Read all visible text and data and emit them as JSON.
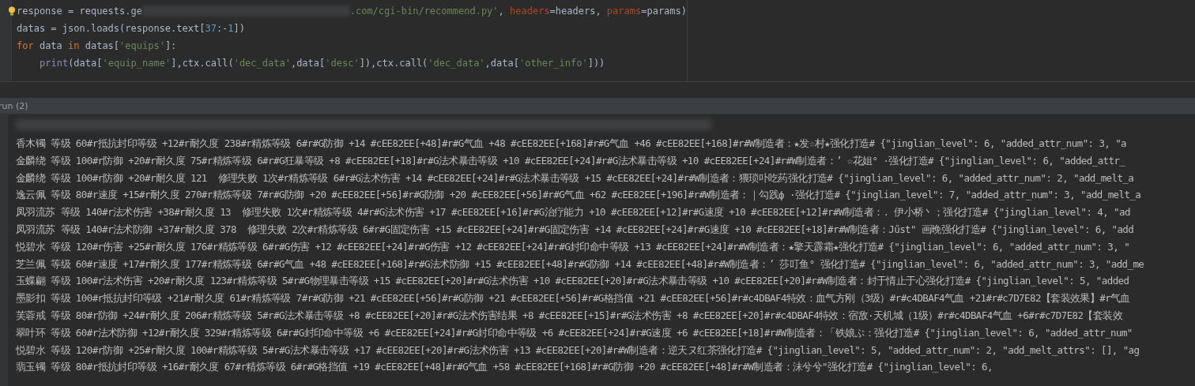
{
  "editor": {
    "lines": [
      {
        "tokens": [
          {
            "kind": "plain",
            "text": "response = requests.ge"
          },
          {
            "kind": "redacted"
          },
          {
            "kind": "string",
            "text": ".com/cgi-bin/recommend.py'"
          },
          {
            "kind": "plain",
            "text": ", "
          },
          {
            "kind": "param",
            "text": "headers"
          },
          {
            "kind": "plain",
            "text": "=headers, "
          },
          {
            "kind": "param",
            "text": "params"
          },
          {
            "kind": "plain",
            "text": "=params)"
          }
        ]
      },
      {
        "tokens": [
          {
            "kind": "plain",
            "text": "datas = json.loads(response.text["
          },
          {
            "kind": "number",
            "text": "37"
          },
          {
            "kind": "plain",
            "text": ":-"
          },
          {
            "kind": "number",
            "text": "1"
          },
          {
            "kind": "plain",
            "text": "])"
          }
        ]
      },
      {
        "tokens": [
          {
            "kind": "keyword",
            "text": "for"
          },
          {
            "kind": "plain",
            "text": " data "
          },
          {
            "kind": "keyword",
            "text": "in"
          },
          {
            "kind": "plain",
            "text": " datas["
          },
          {
            "kind": "string",
            "text": "'equips'"
          },
          {
            "kind": "plain",
            "text": "]:"
          }
        ]
      },
      {
        "indented": true,
        "tokens": [
          {
            "kind": "builtin",
            "text": "print"
          },
          {
            "kind": "plain",
            "text": "(data["
          },
          {
            "kind": "string",
            "text": "'equip_name'"
          },
          {
            "kind": "plain",
            "text": "],ctx.call("
          },
          {
            "kind": "string",
            "text": "'dec_data'"
          },
          {
            "kind": "plain",
            "text": ",data["
          },
          {
            "kind": "string",
            "text": "'desc'"
          },
          {
            "kind": "plain",
            "text": "]),ctx.call("
          },
          {
            "kind": "string",
            "text": "'dec_data'"
          },
          {
            "kind": "plain",
            "text": ",data["
          },
          {
            "kind": "string",
            "text": "'other_info'"
          },
          {
            "kind": "plain",
            "text": "]))"
          }
        ]
      }
    ]
  },
  "run_tab": {
    "label": "run (2)"
  },
  "console": {
    "lines": [
      "香木镯 等级 60#r抵抗封印等级 +12#r耐久度 238#r精炼等级 6#r#G防御 +14 #cEE82EE[+48]#r#G气血 +48 #cEE82EE[+168]#r#G气血 +46 #cEE82EE[+168]#r#W制造者：★发☆村★强化打造# {\"jinglian_level\": 6, \"added_attr_num\": 3, \"a",
      "金麟绕 等级 100#r防御 +20#r耐久度 75#r精炼等级 6#r#G狂暴等级 +8 #cEE82EE[+18]#r#G法术暴击等级 +10 #cEE82EE[+24]#r#G法术暴击等级 +10 #cEE82EE[+24]#r#W制造者：’ ☆花姐° ·强化打造# {\"jinglian_level\": 6, \"added_attr_",
      "金麟绕 等级 100#r防御 +20#r耐久度 121  修理失败 1次#r精炼等级 6#r#G法术伤害 +14 #cEE82EE[+24]#r#G法术暴击等级 +15 #cEE82EE[+24]#r#W制造者：猥琐卟吃药强化打造# {\"jinglian_level\": 6, \"added_attr_num\": 2, \"add_melt_a",
      "逸云佩 等级 80#r速度 +15#r耐久度 270#r精炼等级 7#r#G防御 +20 #cEE82EE[+56]#r#G防御 +20 #cEE82EE[+56]#r#G气血 +62 #cEE82EE[+196]#r#W制造者：｜勾践ф ·强化打造# {\"jinglian_level\": 7, \"added_attr_num\": 3, \"add_melt_a",
      "凤羽流苏 等级 140#r法术伤害 +38#r耐久度 13  修理失败 1次#r精炼等级 4#r#G法术伤害 +17 #cEE82EE[+16]#r#G治疗能力 +10 #cEE82EE[+12]#r#G速度 +10 #cEE82EE[+12]#r#W制造者：. 伊小桥丶；强化打造# {\"jinglian_level\": 4, \"ad",
      "凤羽流苏 等级 140#r法术防御 +37#r耐久度 378  修理失败 2次#r精炼等级 6#r#G固定伤害 +15 #cEE82EE[+24]#r#G固定伤害 +14 #cEE82EE[+24]#r#G速度 +10 #cEE82EE[+18]#r#W制造者：Jűst\" 画晚强化打造# {\"jinglian_level\": 6, \"add",
      "悦碧水 等级 120#r伤害 +25#r耐久度 176#r精炼等级 6#r#G伤害 +12 #cEE82EE[+24]#r#G伤害 +12 #cEE82EE[+24]#r#G封印命中等级 +13 #cEE82EE[+24]#r#W制造者：★擎天霹霜★强化打造# {\"jinglian_level\": 6, \"added_attr_num\": 3, \"",
      "芝兰佩 等级 60#r速度 +17#r耐久度 177#r精炼等级 6#r#G气血 +48 #cEE82EE[+168]#r#G法术防御 +15 #cEE82EE[+48]#r#G防御 +14 #cEE82EE[+48]#r#W制造者：’ 莎叮鱼° 强化打造# {\"jinglian_level\": 6, \"added_attr_num\": 3, \"add_me",
      "玉蝶翩 等级 100#r法术伤害 +20#r耐久度 123#r精炼等级 5#r#G物理暴击等级 +15 #cEE82EE[+20]#r#G法术伤害 +10 #cEE82EE[+20]#r#G法术暴击等级 +10 #cEE82EE[+20]#r#W制造者：封于情止于心强化打造# {\"jinglian_level\": 5, \"added",
      "墨影扣 等级 100#r抵抗封印等级 +21#r耐久度 61#r精炼等级 7#r#G防御 +21 #cEE82EE[+56]#r#G防御 +21 #cEE82EE[+56]#r#G格挡值 +21 #cEE82EE[+56]#r#c4DBAF4特效：血气方刚（3级）#r#c4DBAF4气血 +21#r#c7D7E82【套装效果】#r气血",
      "芙蓉戒 等级 80#r防御 +24#r耐久度 206#r精炼等级 5#r#G法术暴击等级 +8 #cEE82EE[+20]#r#G法术伤害结果 +8 #cEE82EE[+15]#r#G法术伤害 +8 #cEE82EE[+20]#r#c4DBAF4特效：宿敌·天机城（1级）#r#c4DBAF4气血 +6#r#c7D7E82【套装效",
      "翠叶环 等级 60#r法术防御 +12#r耐久度 329#r精炼等级 6#r#G封印命中等级 +6 #cEE82EE[+24]#r#G封印命中等级 +6 #cEE82EE[+24]#r#G速度 +6 #cEE82EE[+18]#r#W制造者：「铁娘ぷ：强化打造# {\"jinglian_level\": 6, \"added_attr_num\"",
      "悦碧水 等级 120#r防御 +25#r耐久度 100#r精炼等级 5#r#G法术暴击等级 +17 #cEE82EE[+20]#r#G法术伤害 +13 #cEE82EE[+20]#r#W制造者：逆天ヌ红茶强化打造# {\"jinglian_level\": 5, \"added_attr_num\": 2, \"add_melt_attrs\": [], \"ag",
      "翡玉镯 等级 80#r抵抗封印等级 +16#r耐久度 67#r精炼等级 6#r#G格挡值 +19 #cEE82EE[+48]#r#G气血 +58 #cEE82EE[+168]#r#G防御 +20 #cEE82EE[+48]#r#W制造者：沫兮兮\"强化打造# {\"jinglian_level\": 6,"
    ]
  }
}
